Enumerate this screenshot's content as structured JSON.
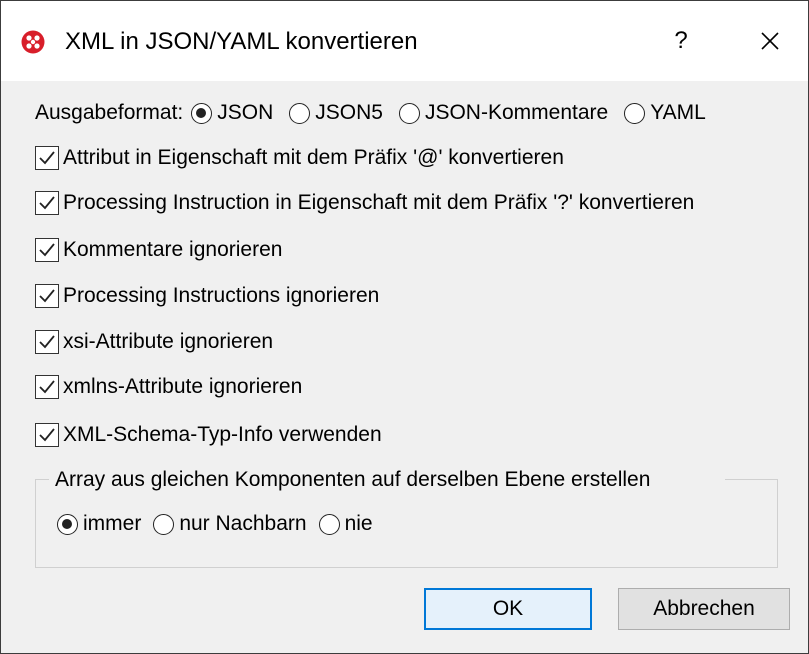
{
  "dialog": {
    "title": "XML in JSON/YAML konvertieren",
    "help_label": "?",
    "accent": "#0078d7"
  },
  "output_format": {
    "label": "Ausgabeformat:",
    "options": [
      "JSON",
      "JSON5",
      "JSON-Kommentare",
      "YAML"
    ],
    "selected": "JSON"
  },
  "options": [
    {
      "label": "Attribut in Eigenschaft mit dem Präfix '@' konvertieren",
      "checked": true
    },
    {
      "label": "Processing Instruction in Eigenschaft mit dem Präfix '?' konvertieren",
      "checked": true
    },
    {
      "label": "Kommentare ignorieren",
      "checked": true
    },
    {
      "label": "Processing Instructions ignorieren",
      "checked": true
    },
    {
      "label": "xsi-Attribute ignorieren",
      "checked": true
    },
    {
      "label": "xmlns-Attribute ignorieren",
      "checked": true
    },
    {
      "label": "XML-Schema-Typ-Info verwenden",
      "checked": true
    }
  ],
  "array_group": {
    "title": "Array aus gleichen Komponenten auf derselben Ebene erstellen",
    "options": [
      "immer",
      "nur Nachbarn",
      "nie"
    ],
    "selected": "immer"
  },
  "buttons": {
    "ok": "OK",
    "cancel": "Abbrechen"
  }
}
